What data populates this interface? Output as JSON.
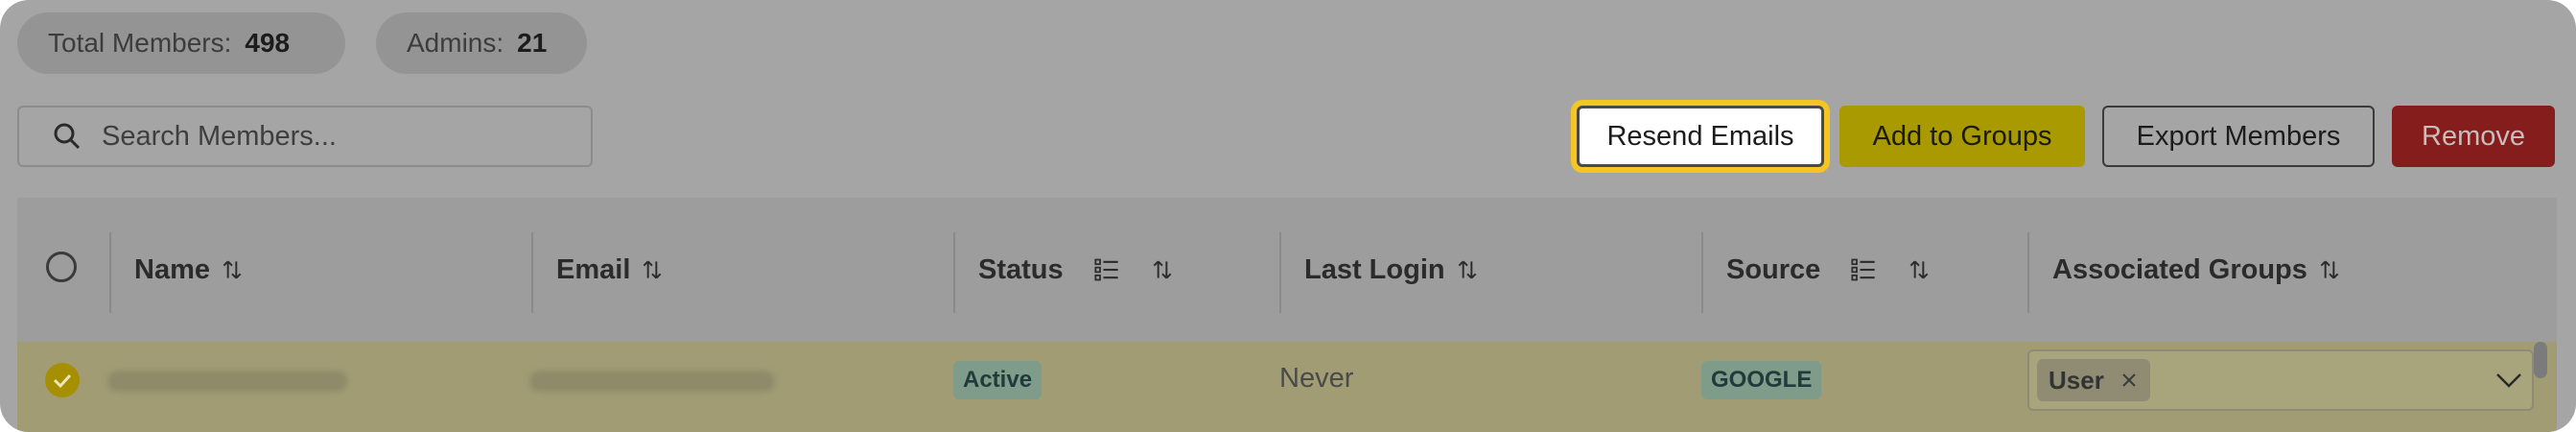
{
  "stats": {
    "total_label": "Total Members:",
    "total_value": "498",
    "admins_label": "Admins:",
    "admins_value": "21"
  },
  "search": {
    "placeholder": "Search Members..."
  },
  "toolbar": {
    "resend": "Resend Emails",
    "add_groups": "Add to Groups",
    "export": "Export Members",
    "remove": "Remove"
  },
  "table": {
    "headers": {
      "name": "Name",
      "email": "Email",
      "status": "Status",
      "last_login": "Last Login",
      "source": "Source",
      "groups": "Associated Groups"
    },
    "rows": [
      {
        "status": "Active",
        "last_login": "Never",
        "source": "GOOGLE",
        "group_chip": "User"
      }
    ]
  },
  "colors": {
    "highlight": "#f5c524",
    "accent": "#a89a00",
    "danger": "#861d1d"
  }
}
